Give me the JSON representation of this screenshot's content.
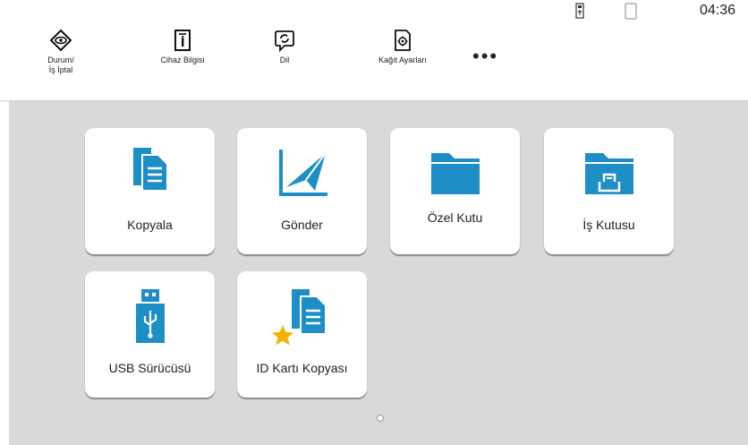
{
  "status": {
    "time": "04:36",
    "icons": [
      "usb-status-icon",
      "paper-sheet-icon"
    ]
  },
  "toolbar": {
    "items": [
      {
        "label": "Durum/\nİş İptal",
        "icon": "eye-icon"
      },
      {
        "label": "Cihaz Bilgisi",
        "icon": "device-info-icon"
      },
      {
        "label": "Dil",
        "icon": "language-icon"
      },
      {
        "label": "Kağıt Ayarları",
        "icon": "paper-settings-icon"
      }
    ],
    "more_label": "•••"
  },
  "tiles": [
    {
      "label": "Kopyala",
      "icon": "copy-icon"
    },
    {
      "label": "Gönder",
      "icon": "send-icon"
    },
    {
      "label": "Özel Kutu",
      "icon": "folder-icon"
    },
    {
      "label": "İş Kutusu",
      "icon": "job-box-icon"
    },
    {
      "label": "USB Sürücüsü",
      "icon": "usb-drive-icon"
    },
    {
      "label": "ID Kartı Kopyası",
      "icon": "id-card-copy-icon"
    }
  ],
  "colors": {
    "accent": "#1e8fc6",
    "star": "#f5b301",
    "background": "#d9d9d9"
  },
  "pagination": {
    "pages": 1,
    "current": 1
  }
}
